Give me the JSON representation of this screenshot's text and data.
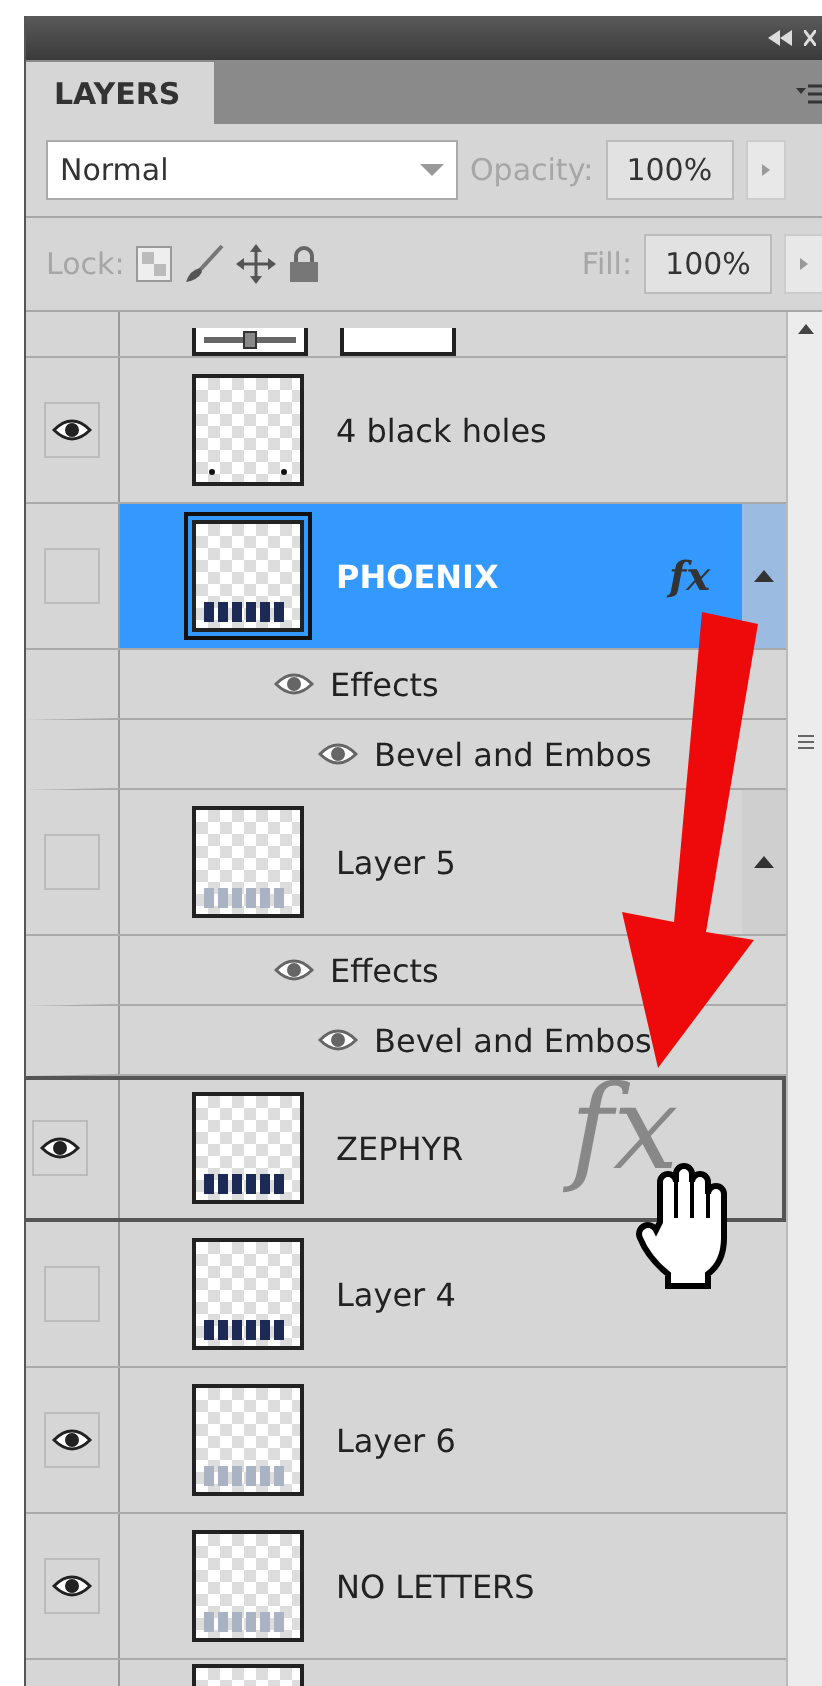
{
  "panel": {
    "tab": "LAYERS",
    "blend_mode": "Normal",
    "opacity_label": "Opacity:",
    "opacity": "100%",
    "lock_label": "Lock:",
    "fill_label": "Fill:",
    "fill": "100%"
  },
  "layers": [
    {
      "name": "4 black holes",
      "visible": true,
      "selected": false,
      "dragging": false,
      "fx": false,
      "thumb": {
        "kind": "dots"
      }
    },
    {
      "name": "PHOENIX",
      "visible": false,
      "selected": true,
      "dragging": false,
      "fx": true,
      "thumb": {
        "kind": "letters"
      },
      "expanded": true,
      "effects": {
        "label": "Effects",
        "visible": true,
        "children": [
          {
            "label": "Bevel and Embos",
            "visible": true
          }
        ]
      }
    },
    {
      "name": "Layer 5",
      "visible": false,
      "selected": false,
      "dragging": false,
      "fx": false,
      "thumb": {
        "kind": "faint"
      },
      "expanded": true,
      "effects": {
        "label": "Effects",
        "visible": true,
        "children": [
          {
            "label": "Bevel and Embos",
            "visible": true
          }
        ]
      }
    },
    {
      "name": "ZEPHYR",
      "visible": true,
      "selected": false,
      "dragging": true,
      "fx": false,
      "thumb": {
        "kind": "letters"
      }
    },
    {
      "name": "Layer 4",
      "visible": false,
      "selected": false,
      "dragging": false,
      "fx": false,
      "thumb": {
        "kind": "letters"
      }
    },
    {
      "name": "Layer 6",
      "visible": true,
      "selected": false,
      "dragging": false,
      "fx": false,
      "thumb": {
        "kind": "faint"
      }
    },
    {
      "name": "NO LETTERS",
      "visible": true,
      "selected": false,
      "dragging": false,
      "fx": false,
      "thumb": {
        "kind": "faint"
      }
    }
  ],
  "fx_badge": "fx",
  "drag_ghost": "fx"
}
